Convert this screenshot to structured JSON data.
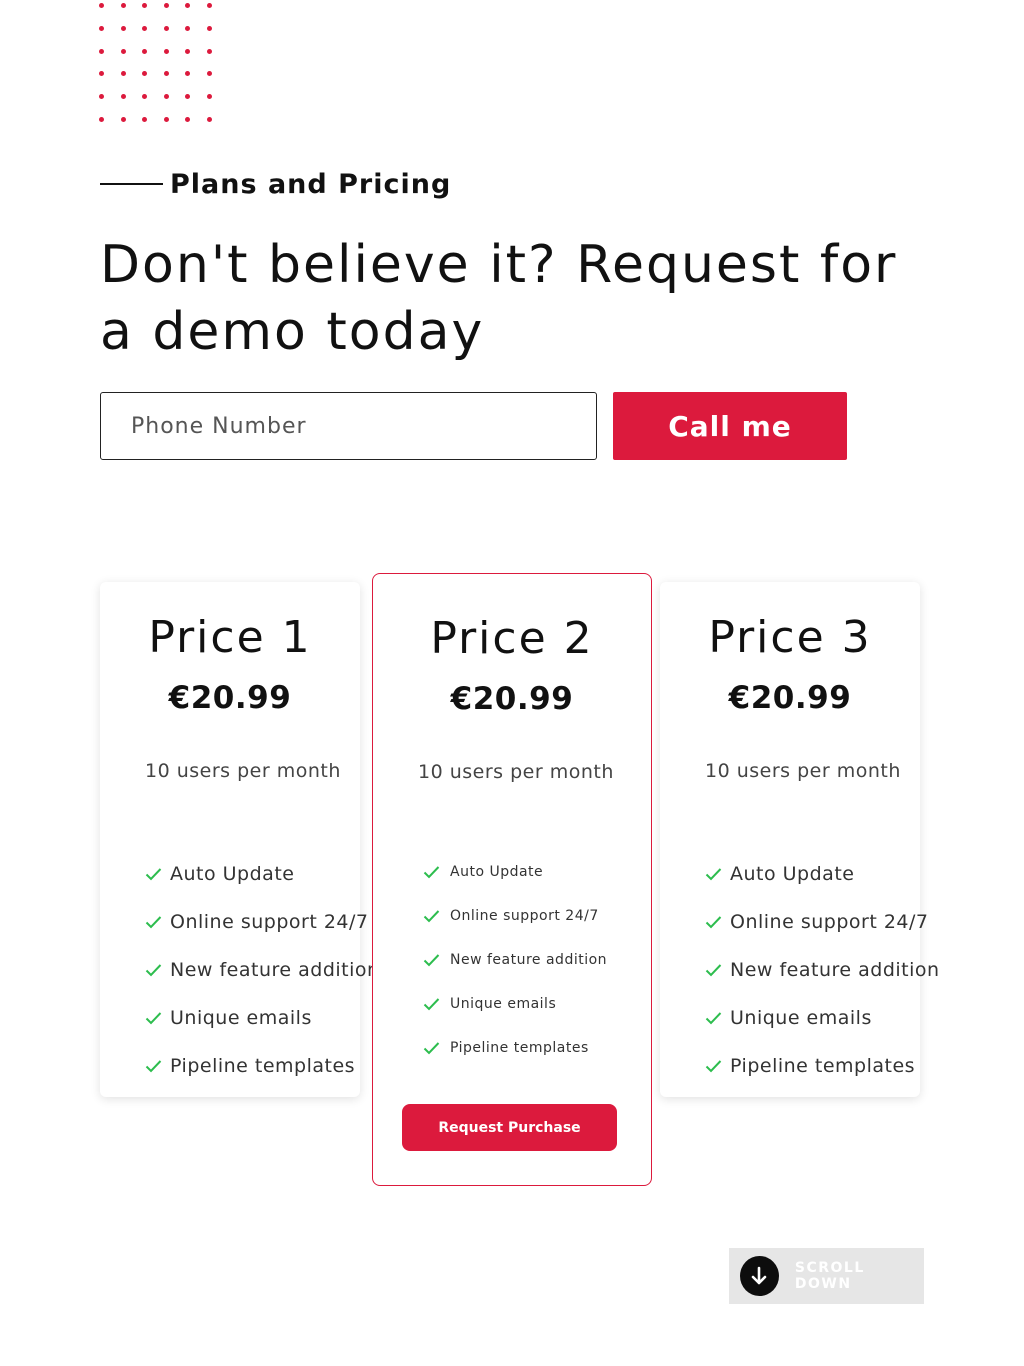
{
  "section": {
    "eyebrow": "Plans and Pricing",
    "headline": "Don't believe it? Request for a demo today"
  },
  "demo_form": {
    "phone_placeholder": "Phone Number",
    "phone_value": "",
    "call_button": "Call me"
  },
  "plans": [
    {
      "title": "Price 1",
      "price": "€20.99",
      "users": "10 users per month",
      "features": [
        "Auto Update",
        "Online support 24/7",
        "New feature addition",
        "Unique emails",
        "Pipeline templates"
      ]
    },
    {
      "title": "Price 2",
      "price": "€20.99",
      "users": "10 users per month",
      "features": [
        "Auto Update",
        "Online support 24/7",
        "New feature addition",
        "Unique emails",
        "Pipeline templates"
      ],
      "button": "Request Purchase",
      "highlighted": true
    },
    {
      "title": "Price 3",
      "price": "€20.99",
      "users": "10 users per month",
      "features": [
        "Auto Update",
        "Online support 24/7",
        "New feature addition",
        "Unique emails",
        "Pipeline templates"
      ]
    }
  ],
  "scroll": {
    "label": "SCROLL DOWN",
    "icon": "arrow-down-icon"
  },
  "colors": {
    "accent": "#dc1a3d",
    "check": "#2dbd4e",
    "text": "#111111"
  }
}
